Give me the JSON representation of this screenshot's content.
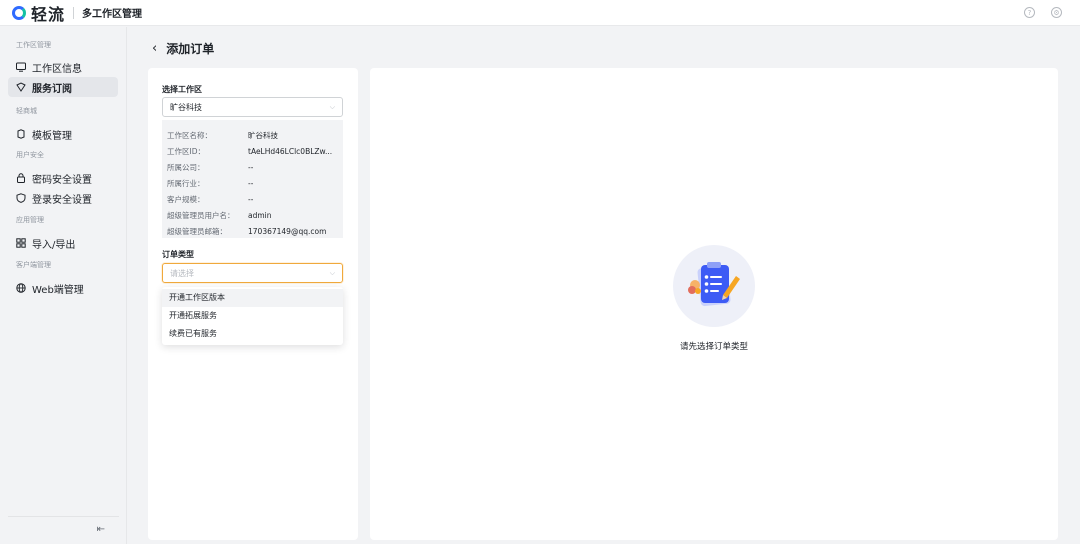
{
  "app": {
    "logo_text": "轻流",
    "title": "多工作区管理"
  },
  "topbar_icons": [
    "help-icon",
    "settings-icon"
  ],
  "sidebar": {
    "groups": [
      {
        "label": "工作区管理",
        "items": [
          {
            "label": "工作区信息",
            "icon": "monitor-icon"
          },
          {
            "label": "服务订阅",
            "icon": "subscription-icon",
            "active": true
          }
        ]
      },
      {
        "label": "轻商城",
        "items": [
          {
            "label": "模板管理",
            "icon": "template-icon"
          }
        ]
      },
      {
        "label": "用户安全",
        "items": [
          {
            "label": "密码安全设置",
            "icon": "lock-icon"
          },
          {
            "label": "登录安全设置",
            "icon": "shield-icon"
          }
        ]
      },
      {
        "label": "应用管理",
        "items": [
          {
            "label": "导入/导出",
            "icon": "grid-icon"
          }
        ]
      },
      {
        "label": "客户端管理",
        "items": [
          {
            "label": "Web端管理",
            "icon": "globe-icon"
          }
        ]
      }
    ],
    "collapse_icon": "collapse-icon"
  },
  "page": {
    "title": "添加订单"
  },
  "form": {
    "workspace_label": "选择工作区",
    "workspace_value": "旷谷科技",
    "info": [
      {
        "key": "工作区名称：",
        "value": "旷谷科技"
      },
      {
        "key": "工作区ID：",
        "value": "tAeLHd46LClc0BLZw..."
      },
      {
        "key": "所属公司：",
        "value": "--"
      },
      {
        "key": "所属行业：",
        "value": "--"
      },
      {
        "key": "客户规模：",
        "value": "--"
      },
      {
        "key": "超级管理员用户名：",
        "value": "admin"
      },
      {
        "key": "超级管理员邮箱：",
        "value": "170367149@qq.com"
      }
    ],
    "order_type_label": "订单类型",
    "order_type_placeholder": "请选择",
    "order_type_options": [
      "开通工作区版本",
      "开通拓展服务",
      "续费已有服务"
    ]
  },
  "empty_state": {
    "text": "请先选择订单类型"
  },
  "colors": {
    "accent_focus": "#f0a93c",
    "brand_blue": "#2f6bff",
    "illus_blue": "#3d5bf5"
  }
}
